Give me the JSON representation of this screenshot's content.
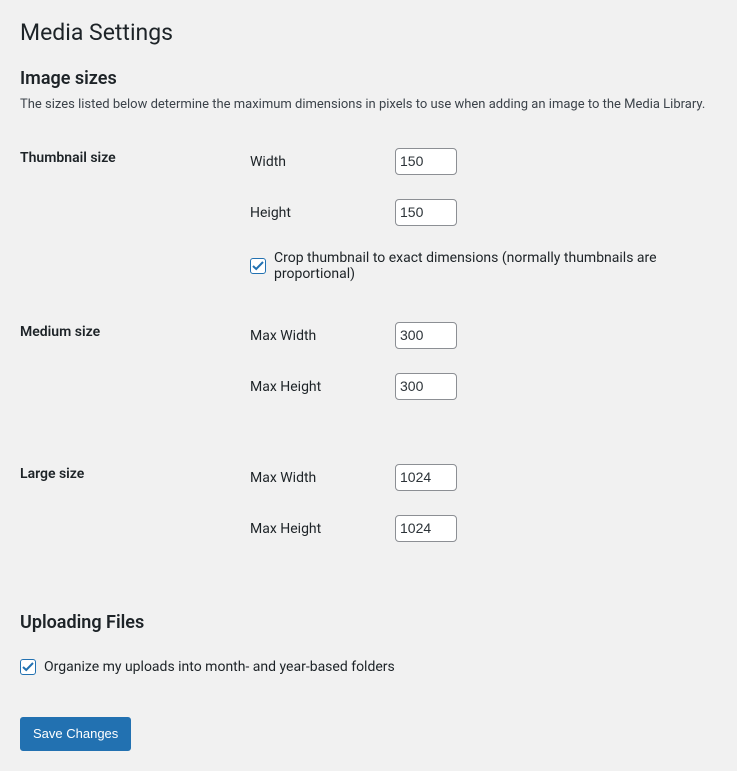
{
  "page": {
    "title": "Media Settings"
  },
  "image_sizes": {
    "heading": "Image sizes",
    "description": "The sizes listed below determine the maximum dimensions in pixels to use when adding an image to the Media Library.",
    "thumbnail": {
      "label": "Thumbnail size",
      "width_label": "Width",
      "width_value": "150",
      "height_label": "Height",
      "height_value": "150",
      "crop_label": "Crop thumbnail to exact dimensions (normally thumbnails are proportional)",
      "crop_checked": true
    },
    "medium": {
      "label": "Medium size",
      "width_label": "Max Width",
      "width_value": "300",
      "height_label": "Max Height",
      "height_value": "300"
    },
    "large": {
      "label": "Large size",
      "width_label": "Max Width",
      "width_value": "1024",
      "height_label": "Max Height",
      "height_value": "1024"
    }
  },
  "uploading": {
    "heading": "Uploading Files",
    "organize_label": "Organize my uploads into month- and year-based folders",
    "organize_checked": true
  },
  "submit": {
    "label": "Save Changes"
  }
}
